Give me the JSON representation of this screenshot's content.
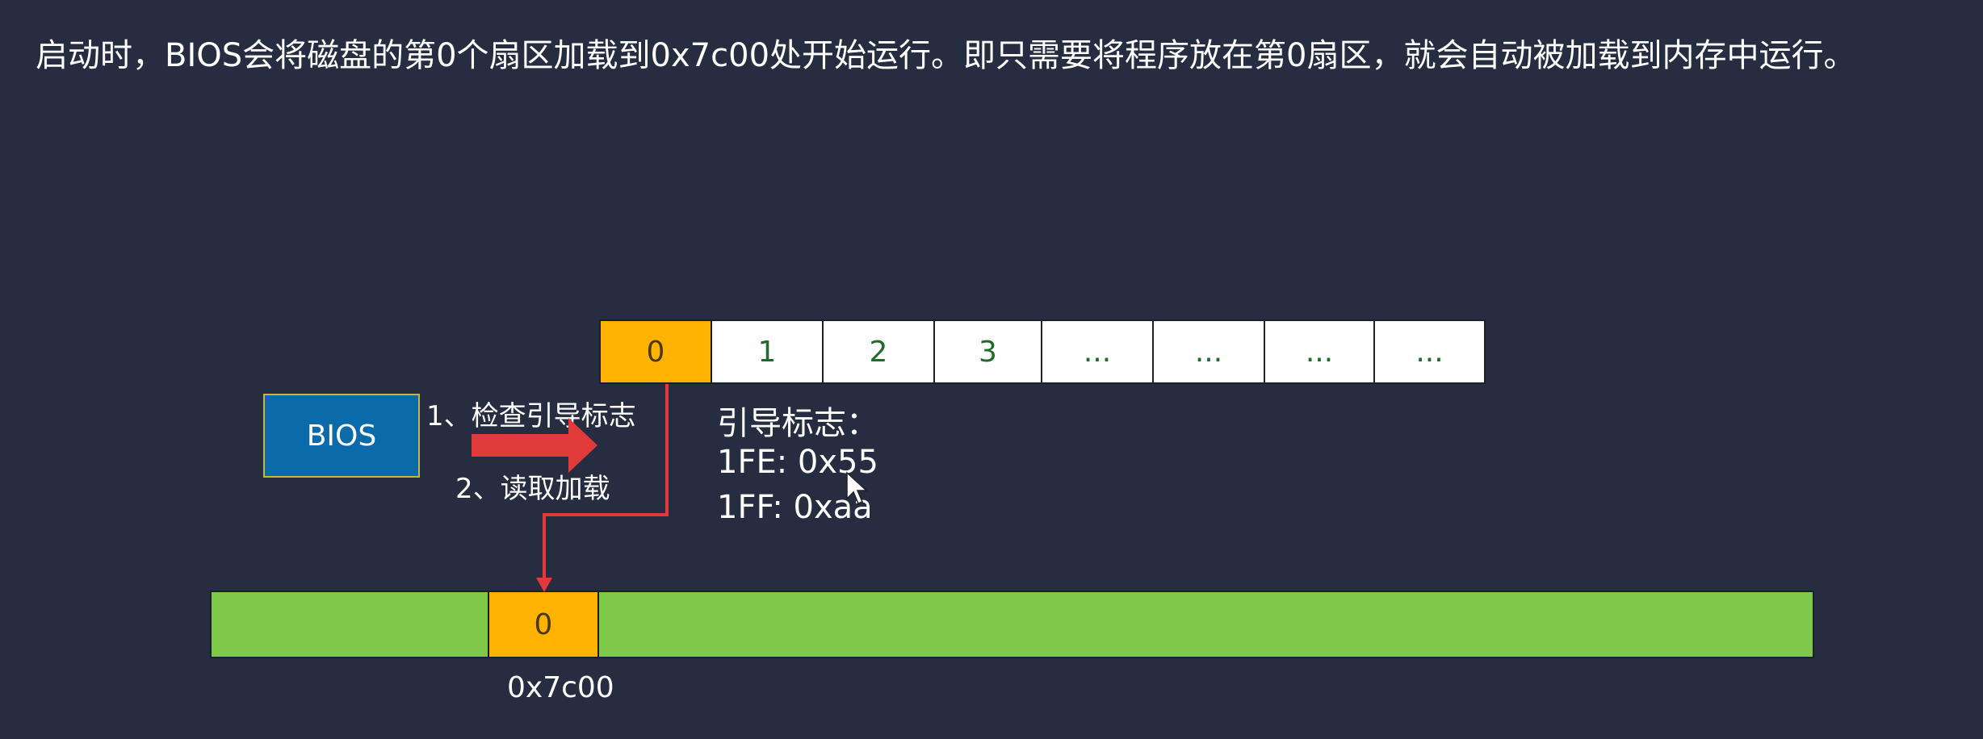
{
  "description": "启动时，BIOS会将磁盘的第0个扇区加载到0x7c00处开始运行。即只需要将程序放在第0扇区，就会自动被加载到内存中运行。",
  "disk": {
    "sectors": [
      "0",
      "1",
      "2",
      "3",
      "...",
      "...",
      "...",
      "..."
    ]
  },
  "bios": {
    "label": "BIOS"
  },
  "steps": {
    "check": "1、检查引导标志",
    "load": "2、读取加载"
  },
  "boot_flag": {
    "title": "引导标志：",
    "byte_1fe": "1FE: 0x55",
    "byte_1ff": "1FF: 0xaa"
  },
  "memory": {
    "sector_label": "0",
    "address": "0x7c00"
  },
  "colors": {
    "background": "#262d40",
    "sector_highlight": "#ffb300",
    "memory": "#7ec84a",
    "bios": "#0b6aa9",
    "arrow": "#e03a3a"
  }
}
